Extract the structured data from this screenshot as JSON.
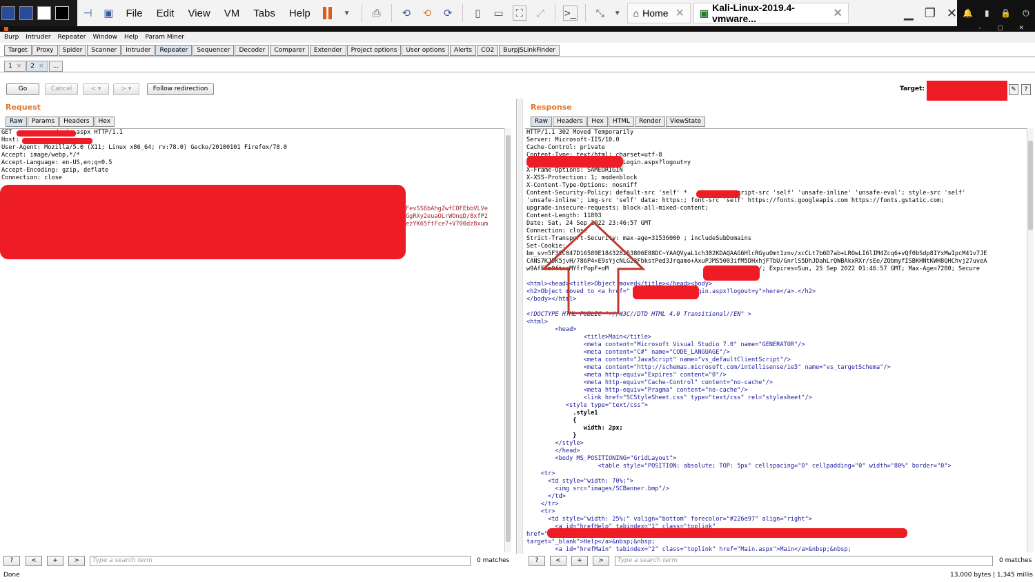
{
  "vmware": {
    "menus": [
      "File",
      "Edit",
      "View",
      "VM",
      "Tabs",
      "Help"
    ],
    "tabs": [
      {
        "label": "Home"
      },
      {
        "label": "Kali-Linux-2019.4-vmware..."
      }
    ]
  },
  "burp_menu": [
    "Burp",
    "Intruder",
    "Repeater",
    "Window",
    "Help",
    "Param Miner"
  ],
  "main_tabs": [
    "Target",
    "Proxy",
    "Spider",
    "Scanner",
    "Intruder",
    "Repeater",
    "Sequencer",
    "Decoder",
    "Comparer",
    "Extender",
    "Project options",
    "User options",
    "Alerts",
    "CO2",
    "BurpJSLinkFinder"
  ],
  "main_tabs_active": "Repeater",
  "repeater_tabs": [
    "1",
    "2",
    "..."
  ],
  "toolbar": {
    "go": "Go",
    "cancel": "Cancel",
    "back": "< ▾",
    "forward": "> ▾",
    "follow": "Follow redirection",
    "target_label": "Target:",
    "edit": "✎",
    "help": "?"
  },
  "request": {
    "title": "Request",
    "tabs": [
      "Raw",
      "Params",
      "Headers",
      "Hex"
    ],
    "lines": [
      "GET            /main.aspx HTTP/1.1",
      "Host:",
      "User-Agent: Mozilla/5.0 (X11; Linux x86_64; rv:78.0) Gecko/20100101 Firefox/78.0",
      "Accept: image/webp,*/*",
      "Accept-Language: en-US,en;q=0.5",
      "Accept-Encoding: gzip, deflate",
      "Connection: close"
    ],
    "cookie_tail": [
      "FevSS6bAhgZwfCOFEbbVLVe",
      "GgRXy2euaOLrWOnqD/8xfP2",
      "ezYK65ftFce7+V700dz8xum"
    ]
  },
  "response": {
    "title": "Response",
    "tabs": [
      "Raw",
      "Headers",
      "Hex",
      "HTML",
      "Render",
      "ViewState"
    ],
    "header_lines": [
      "HTTP/1.1 302 Moved Temporarily",
      "Server: Microsoft-IIS/10.0",
      "Cache-Control: private",
      "Content-Type: text/html; charset=utf-8",
      "                          /Login.aspx?logout=y",
      "X-Frame-Options: SAMEORIGIN",
      "X-XSS-Protection: 1; mode=block",
      "X-Content-Type-Options: nosniff",
      "Content-Security-Policy: default-src 'self' *             script-src 'self' 'unsafe-inline' 'unsafe-eval'; style-src 'self'",
      "'unsafe-inline'; img-src 'self' data: https:; font-src 'self' https://fonts.googleapis.com https://fonts.gstatic.com;",
      "upgrade-insecure-requests; block-all-mixed-content;",
      "Content-Length: 11893",
      "Date: Sat, 24 Sep 2022 23:46:57 GMT",
      "Connection: close",
      "Strict-Transport-Security: max-age=31536000 ; includeSubDomains",
      "Set-Cookie:",
      "bm_sv=5F3CC047D16589E184328253806E88DC~YAAQVyaL1ch302KDAQAAG6HlcRGyuOmt1znv/xcCLt7b6D7ab+LROwLI6lIM4Zcq6+vQf0bSdp8IYxMwIpcM41v7JE",
      "CANS7KJ5K5jvH/786P4+E9sYjcNLG23FbkstPed3Jrqamo+AxuPJMS5003ifM5DHxhjFTbU/GnrlS5DhJDahLrQWBAkxRXr/sEe/ZQbmyfISBKHNtKWH8QHChvj27uveA",
      "w9AfF7m0ftxeMYfrPopF+oM                                      ath=/; Expires=Sun, 25 Sep 2022 01:46:57 GMT; Max-Age=7200; Secure"
    ],
    "body_lines": [
      {
        "t": "<html><head><title>Object moved</title></head><body>",
        "c": "tag"
      },
      {
        "t": "<h2>Object moved to <a href=\"                 Login.aspx?logout=y\">here</a>.</h2>",
        "c": "tag"
      },
      {
        "t": "</body></html>",
        "c": "tag"
      },
      {
        "t": "",
        "c": ""
      },
      {
        "t": "<!DOCTYPE HTML PUBLIC \"-//W3C//DTD HTML 4.0 Transitional//EN\" >",
        "c": "cmt"
      },
      {
        "t": "<html>",
        "c": "tag"
      },
      {
        "t": "        <head>",
        "c": "tag"
      },
      {
        "t": "                <title>Main</title>",
        "c": "tag"
      },
      {
        "t": "                <meta content=\"Microsoft Visual Studio 7.0\" name=\"GENERATOR\"/>",
        "c": "tag"
      },
      {
        "t": "                <meta content=\"C#\" name=\"CODE_LANGUAGE\"/>",
        "c": "tag"
      },
      {
        "t": "                <meta content=\"JavaScript\" name=\"vs_defaultClientScript\"/>",
        "c": "tag"
      },
      {
        "t": "                <meta content=\"http://schemas.microsoft.com/intellisense/ie5\" name=\"vs_targetSchema\"/>",
        "c": "tag"
      },
      {
        "t": "                <meta http-equiv=\"Expires\" content=\"0\"/>",
        "c": "tag"
      },
      {
        "t": "                <meta http-equiv=\"Cache-Control\" content=\"no-cache\"/>",
        "c": "tag"
      },
      {
        "t": "                <meta http-equiv=\"Pragma\" content=\"no-cache\"/>",
        "c": "tag"
      },
      {
        "t": "                <link href=\"SCStyleSheet.css\" type=\"text/css\" rel=\"stylesheet\"/>",
        "c": "tag"
      },
      {
        "t": "           <style type=\"text/css\">",
        "c": "tag"
      },
      {
        "t": "             .style1",
        "c": "b"
      },
      {
        "t": "             {",
        "c": "b"
      },
      {
        "t": "                width: 2px;",
        "c": "b"
      },
      {
        "t": "             }",
        "c": "b"
      },
      {
        "t": "        </style>",
        "c": "tag"
      },
      {
        "t": "        </head>",
        "c": "tag"
      },
      {
        "t": "        <body MS_POSITIONING=\"GridLayout\">",
        "c": "tag"
      },
      {
        "t": "                    <table style=\"POSITION: absolute; TOP: 5px\" cellspacing=\"0\" cellpadding=\"0\" width=\"80%\" border=\"0\">",
        "c": "tag"
      },
      {
        "t": "    <tr>",
        "c": "tag"
      },
      {
        "t": "      <td style=\"width: 70%;\">",
        "c": "tag"
      },
      {
        "t": "        <img src=\"images/SCBanner.bmp\"/>",
        "c": "tag"
      },
      {
        "t": "      </td>",
        "c": "tag"
      },
      {
        "t": "    </tr>",
        "c": "tag"
      },
      {
        "t": "    <tr>",
        "c": "tag"
      },
      {
        "t": "      <td style=\"width: 25%;\" valign=\"bottom\" forecolor=\"#226e97\" align=\"right\">",
        "c": "tag"
      },
      {
        "t": "        <a id=\"hrefHelp\" tabindex=\"1\" class=\"toplink\"",
        "c": "tag"
      },
      {
        "t": "href=\"                                                                                m\"",
        "c": "tag"
      },
      {
        "t": "target=\"_blank\">Help</a>&nbsp;&nbsp;",
        "c": "tag"
      },
      {
        "t": "        <a id=\"hrefMain\" tabindex=\"2\" class=\"toplink\" href=\"Main.aspx\">Main</a>&nbsp;&nbsp;",
        "c": "tag"
      }
    ]
  },
  "search": {
    "help": "?",
    "prev": "<",
    "add": "+",
    "next": ">",
    "placeholder": "Type a search term",
    "matches": "0 matches"
  },
  "status": {
    "left": "Done",
    "right": "13,000 bytes | 1,345 millis"
  },
  "colors": {
    "pane_title": "#e0782a",
    "redaction": "#ee1c25",
    "arrow": "#c0392b"
  }
}
